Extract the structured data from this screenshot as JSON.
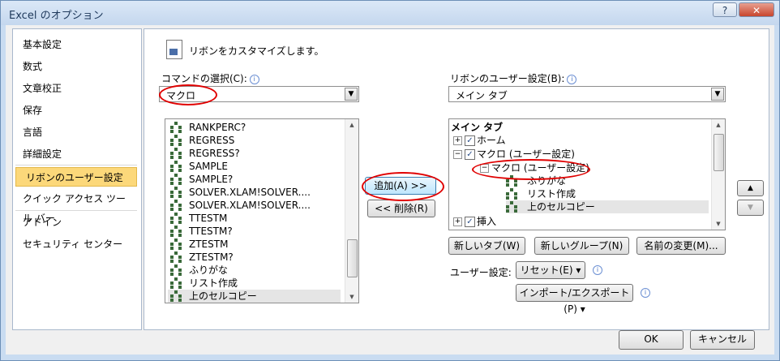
{
  "window": {
    "title": "Excel のオプション",
    "help_label": "?",
    "close_label": "✕"
  },
  "nav": {
    "items": [
      {
        "label": "基本設定"
      },
      {
        "label": "数式"
      },
      {
        "label": "文章校正"
      },
      {
        "label": "保存"
      },
      {
        "label": "言語"
      },
      {
        "label": "詳細設定"
      },
      {
        "label": "リボンのユーザー設定",
        "selected": true
      },
      {
        "label": "クイック アクセス ツール バー"
      },
      {
        "label": "アドイン"
      },
      {
        "label": "セキュリティ センター"
      }
    ]
  },
  "header": {
    "text": "リボンをカスタマイズします。",
    "icon": "customize-ribbon-icon"
  },
  "commands": {
    "label": "コマンドの選択(C):",
    "selected": "マクロ",
    "items": [
      "RANKPERC?",
      "REGRESS",
      "REGRESS?",
      "SAMPLE",
      "SAMPLE?",
      "SOLVER.XLAM!SOLVER....",
      "SOLVER.XLAM!SOLVER....",
      "TTESTM",
      "TTESTM?",
      "ZTESTM",
      "ZTESTM?",
      "ふりがな",
      "リスト作成",
      "上のセルコピー"
    ],
    "selected_item": "上のセルコピー"
  },
  "middle": {
    "add_label": "追加(A) >>",
    "remove_label": "<< 削除(R)"
  },
  "ribbon": {
    "label": "リボンのユーザー設定(B):",
    "selected": "メイン タブ",
    "tree": {
      "header": "メイン タブ",
      "home": "ホーム",
      "macro_tab": "マクロ (ユーザー設定)",
      "macro_group": "マクロ (ユーザー設定)",
      "children": [
        "ふりがな",
        "リスト作成",
        "上のセルコピー"
      ],
      "insert": "挿入"
    },
    "new_tab_label": "新しいタブ(W)",
    "new_group_label": "新しいグループ(N)",
    "rename_label": "名前の変更(M)...",
    "custom_label": "ユーザー設定:",
    "reset_label": "リセット(E) ▾",
    "import_label": "インポート/エクスポート(P) ▾"
  },
  "updown": {
    "up": "▲",
    "down": "▼"
  },
  "footer": {
    "ok_label": "OK",
    "cancel_label": "キャンセル"
  },
  "colors": {
    "selection": "#fcd87a",
    "highlight_ring": "#e00000",
    "title_text": "#1e395b"
  }
}
